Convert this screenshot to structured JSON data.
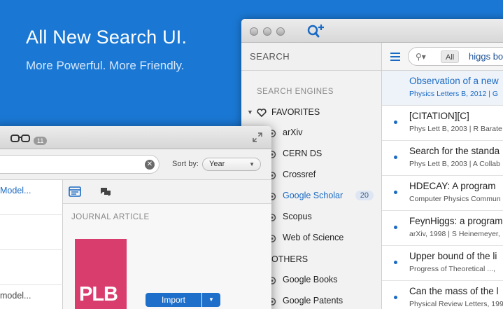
{
  "hero": {
    "title": "All New Search UI.",
    "subtitle": "More Powerful. More Friendly."
  },
  "back_window": {
    "sidebar": {
      "header": "SEARCH",
      "section_engines": "SEARCH ENGINES",
      "group_favorites": "FAVORITES",
      "items": [
        {
          "label": "arXiv"
        },
        {
          "label": "CERN DS"
        },
        {
          "label": "Crossref"
        },
        {
          "label": "Google Scholar",
          "badge": "20"
        },
        {
          "label": "Scopus"
        },
        {
          "label": "Web of Science"
        }
      ],
      "group_others": "OTHERS",
      "others": [
        {
          "label": "Google Books"
        },
        {
          "label": "Google Patents"
        }
      ]
    },
    "search": {
      "scope": "All",
      "query": "higgs bo"
    },
    "results": [
      {
        "title": "Observation of a new",
        "subtitle": "Physics Letters B, 2012 | G",
        "selected": true
      },
      {
        "title": "[CITATION][C]",
        "subtitle": "Phys Lett B, 2003 | R Barate"
      },
      {
        "title": "Search for the standa",
        "subtitle": "Phys Lett B, 2003 | A Collab"
      },
      {
        "title": "HDECAY: A program",
        "subtitle": "Computer Physics Commun"
      },
      {
        "title": "FeynHiggs: a program",
        "subtitle": "arXiv, 1998 | S Heinemeyer,"
      },
      {
        "title": "Upper bound of the li",
        "subtitle": "Progress of Theoretical ..., "
      },
      {
        "title": "Can the mass of the l",
        "subtitle": "Physical Review Letters, 199"
      }
    ]
  },
  "front_window": {
    "count": "11",
    "sort_label": "Sort by:",
    "sort_value": "Year",
    "list": [
      {
        "text": "Model...",
        "style": "blue"
      },
      {
        "text": "",
        "style": "gray"
      },
      {
        "text": "",
        "style": "gray"
      },
      {
        "text": "model...",
        "style": "gray"
      }
    ],
    "detail": {
      "doc_type": "JOURNAL ARTICLE",
      "cover_text": "PLB",
      "import_label": "Import"
    }
  },
  "colors": {
    "background": "#1a78d4",
    "accent": "#1a6ac4",
    "cover": "#d83d6e"
  }
}
